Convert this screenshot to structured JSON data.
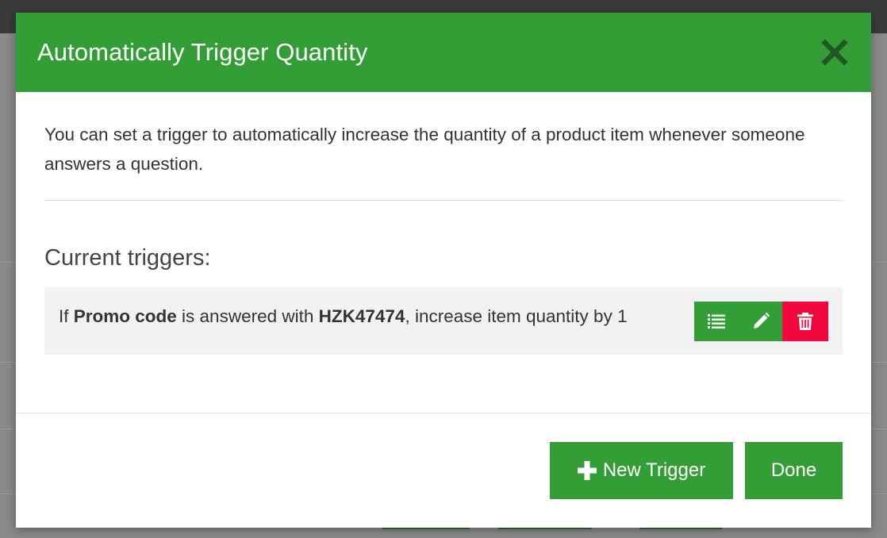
{
  "modal": {
    "title": "Automatically Trigger Quantity",
    "close_icon": "close-icon",
    "intro": "You can set a trigger to automatically increase the quantity of a product item whenever someone answers a question.",
    "section_title": "Current triggers:"
  },
  "triggers": [
    {
      "prefix": "If ",
      "question": "Promo code",
      "middle": " is answered with ",
      "answer": "HZK47474",
      "suffix": ", increase item quantity by 1",
      "actions": [
        "list-icon",
        "pencil-icon",
        "trash-icon"
      ]
    }
  ],
  "footer": {
    "new_trigger_label": "New Trigger",
    "done_label": "Done"
  },
  "colors": {
    "accent_green": "#339e35",
    "danger_red": "#f0083f",
    "row_background": "#f2f2f2"
  }
}
